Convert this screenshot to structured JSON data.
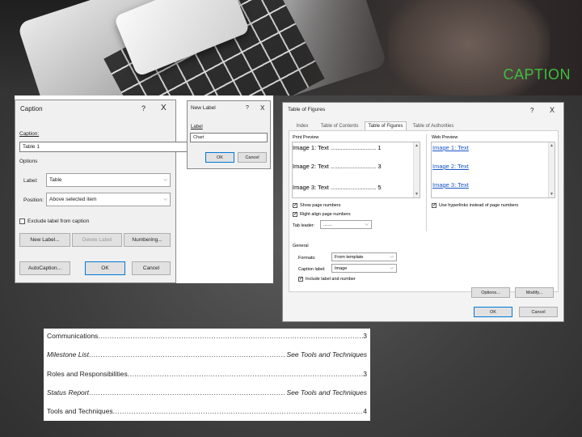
{
  "slide": {
    "title": "CAPTION"
  },
  "caption_dialog": {
    "title": "Caption",
    "help": "?",
    "close": "X",
    "caption_label": "Caption:",
    "caption_value": "Table 1",
    "options_label": "Options",
    "label_label": "Label:",
    "label_value": "Table",
    "position_label": "Position:",
    "position_value": "Above selected item",
    "exclude_label": "Exclude label from caption",
    "new_label_btn": "New Label...",
    "delete_label_btn": "Delete Label",
    "numbering_btn": "Numbering...",
    "autocaption_btn": "AutoCaption...",
    "ok_btn": "OK",
    "cancel_btn": "Cancel"
  },
  "new_label_dialog": {
    "title": "New Label",
    "help": "?",
    "close": "X",
    "label_label": "Label",
    "label_value": "Chart",
    "ok_btn": "OK",
    "cancel_btn": "Cancel"
  },
  "tof_dialog": {
    "title": "Table of Figures",
    "help": "?",
    "close": "X",
    "tabs": [
      "Index",
      "Table of Contents",
      "Table of Figures",
      "Table of Authorities"
    ],
    "print_preview_label": "Print Preview",
    "web_preview_label": "Web Preview",
    "print_items": [
      {
        "text": "Image 1: Text",
        "page": "1"
      },
      {
        "text": "Image 2: Text",
        "page": "3"
      },
      {
        "text": "Image 3: Text",
        "page": "5"
      }
    ],
    "web_items": [
      "Image 1: Text",
      "Image 2: Text",
      "Image 3: Text"
    ],
    "show_page_numbers": "Show page numbers",
    "right_align": "Right align page numbers",
    "tab_leader_label": "Tab leader:",
    "tab_leader_value": ".......",
    "use_hyperlinks": "Use hyperlinks instead of page numbers",
    "general_label": "General",
    "formats_label": "Formats:",
    "formats_value": "From template",
    "caption_label_label": "Caption label:",
    "caption_label_value": "Image",
    "include_label": "Include label and number",
    "options_btn": "Options...",
    "modify_btn": "Modify...",
    "ok_btn": "OK",
    "cancel_btn": "Cancel"
  },
  "toc": [
    {
      "title": "Communications",
      "page": "3",
      "italic": false
    },
    {
      "title": "Milestone List",
      "page": "See Tools and Techniques",
      "italic": true
    },
    {
      "title": "Roles and Responsibilities",
      "page": "3",
      "italic": false
    },
    {
      "title": "Status Report",
      "page": "See Tools and Techniques",
      "italic": true
    },
    {
      "title": "Tools and Techniques",
      "page": "4",
      "italic": false
    }
  ],
  "colors": {
    "title_green": "#3fbf3f",
    "accent_blue": "#0078d7",
    "link_blue": "#1a57c9"
  }
}
